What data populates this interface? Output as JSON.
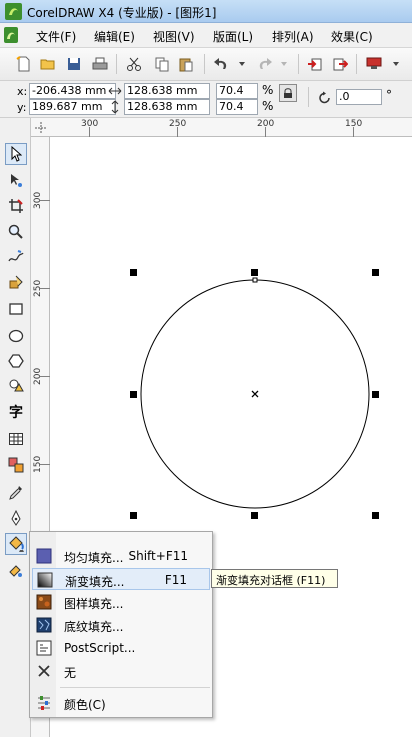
{
  "window": {
    "title": "CorelDRAW X4 (专业版) - [图形1]"
  },
  "menubar": {
    "items": [
      {
        "label": "文件(F)"
      },
      {
        "label": "编辑(E)"
      },
      {
        "label": "视图(V)"
      },
      {
        "label": "版面(L)"
      },
      {
        "label": "排列(A)"
      },
      {
        "label": "效果(C)"
      }
    ]
  },
  "toolbar": {
    "icons": [
      "new-icon",
      "open-icon",
      "save-icon",
      "print-icon",
      "cut-icon",
      "copy-icon",
      "paste-icon",
      "undo-icon",
      "redo-icon",
      "import-icon",
      "export-icon",
      "application-launcher-icon"
    ]
  },
  "propertybar": {
    "x_label": "x:",
    "x_value": "-206.438 mm",
    "y_label": "y:",
    "y_value": "189.687 mm",
    "width_value": "128.638 mm",
    "height_value": "128.638 mm",
    "scale_x": "70.4",
    "scale_y": "70.4",
    "percent": "%",
    "rotation_value": ".0",
    "degree": "°"
  },
  "rulers": {
    "top_labels": [
      "300",
      "250",
      "200",
      "150"
    ],
    "left_labels": [
      "300",
      "250",
      "200",
      "150"
    ]
  },
  "toolbox": {
    "text_tool_glyph": "字"
  },
  "fill_flyout": {
    "items": [
      {
        "label": "均匀填充...",
        "shortcut": "Shift+F11",
        "icon": "uniform-fill-icon"
      },
      {
        "label": "渐变填充...",
        "shortcut": "F11",
        "icon": "fountain-fill-icon",
        "highlighted": true
      },
      {
        "label": "图样填充...",
        "shortcut": "",
        "icon": "pattern-fill-icon"
      },
      {
        "label": "底纹填充...",
        "shortcut": "",
        "icon": "texture-fill-icon"
      },
      {
        "label": "PostScript...",
        "shortcut": "",
        "icon": "postscript-fill-icon"
      },
      {
        "label": "无",
        "shortcut": "",
        "icon": "no-fill-icon"
      },
      {
        "label": "颜色(C)",
        "shortcut": "",
        "icon": "color-docker-icon"
      }
    ]
  },
  "tooltip": {
    "text": "渐变填充对话框 (F11)"
  },
  "colors": {
    "selection_handles": "#000000",
    "highlight": "#e3edf9",
    "tooltip_bg": "#ffffe8"
  }
}
